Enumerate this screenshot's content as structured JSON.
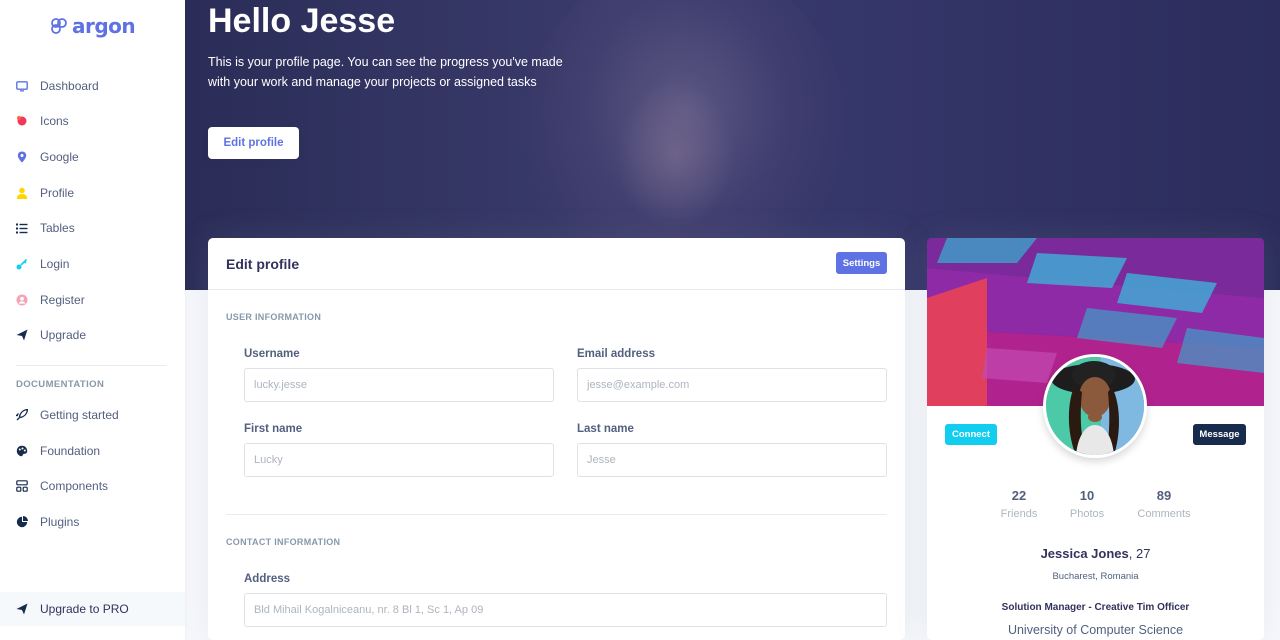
{
  "brand": {
    "name": "argon"
  },
  "sidebar": {
    "items": [
      {
        "label": "Dashboard",
        "icon": "tv-icon"
      },
      {
        "label": "Icons",
        "icon": "planet-icon"
      },
      {
        "label": "Google",
        "icon": "pin-icon"
      },
      {
        "label": "Profile",
        "icon": "user-icon"
      },
      {
        "label": "Tables",
        "icon": "list-icon"
      },
      {
        "label": "Login",
        "icon": "key-icon"
      },
      {
        "label": "Register",
        "icon": "circle-user-icon"
      },
      {
        "label": "Upgrade",
        "icon": "send-icon"
      }
    ],
    "doc_heading": "DOCUMENTATION",
    "doc_items": [
      {
        "label": "Getting started",
        "icon": "rocket-icon"
      },
      {
        "label": "Foundation",
        "icon": "palette-icon"
      },
      {
        "label": "Components",
        "icon": "components-icon"
      },
      {
        "label": "Plugins",
        "icon": "chart-pie-icon"
      }
    ],
    "pro_label": "Upgrade to PRO"
  },
  "hero": {
    "title": "Hello Jesse",
    "text": "This is your profile page. You can see the progress you've made with your work and manage your projects or assigned tasks",
    "button": "Edit profile"
  },
  "edit_card": {
    "title": "Edit profile",
    "settings_button": "Settings",
    "user_section": "USER INFORMATION",
    "contact_section": "CONTACT INFORMATION",
    "fields": {
      "username": {
        "label": "Username",
        "placeholder": "lucky.jesse"
      },
      "email": {
        "label": "Email address",
        "placeholder": "jesse@example.com"
      },
      "first_name": {
        "label": "First name",
        "placeholder": "Lucky"
      },
      "last_name": {
        "label": "Last name",
        "placeholder": "Jesse"
      },
      "address": {
        "label": "Address",
        "placeholder": "Bld Mihail Kogalniceanu, nr. 8 Bl 1, Sc 1, Ap 09"
      }
    }
  },
  "profile_card": {
    "connect_button": "Connect",
    "message_button": "Message",
    "stats": [
      {
        "value": "22",
        "label": "Friends"
      },
      {
        "value": "10",
        "label": "Photos"
      },
      {
        "value": "89",
        "label": "Comments"
      }
    ],
    "name": "Jessica Jones",
    "age": ", 27",
    "location": "Bucharest, Romania",
    "job": "Solution Manager - Creative Tim Officer",
    "school": "University of Computer Science"
  },
  "colors": {
    "primary": "#5e72e4",
    "info": "#11cdef",
    "default": "#172b4d",
    "hero_bg": "#2b2d58"
  }
}
